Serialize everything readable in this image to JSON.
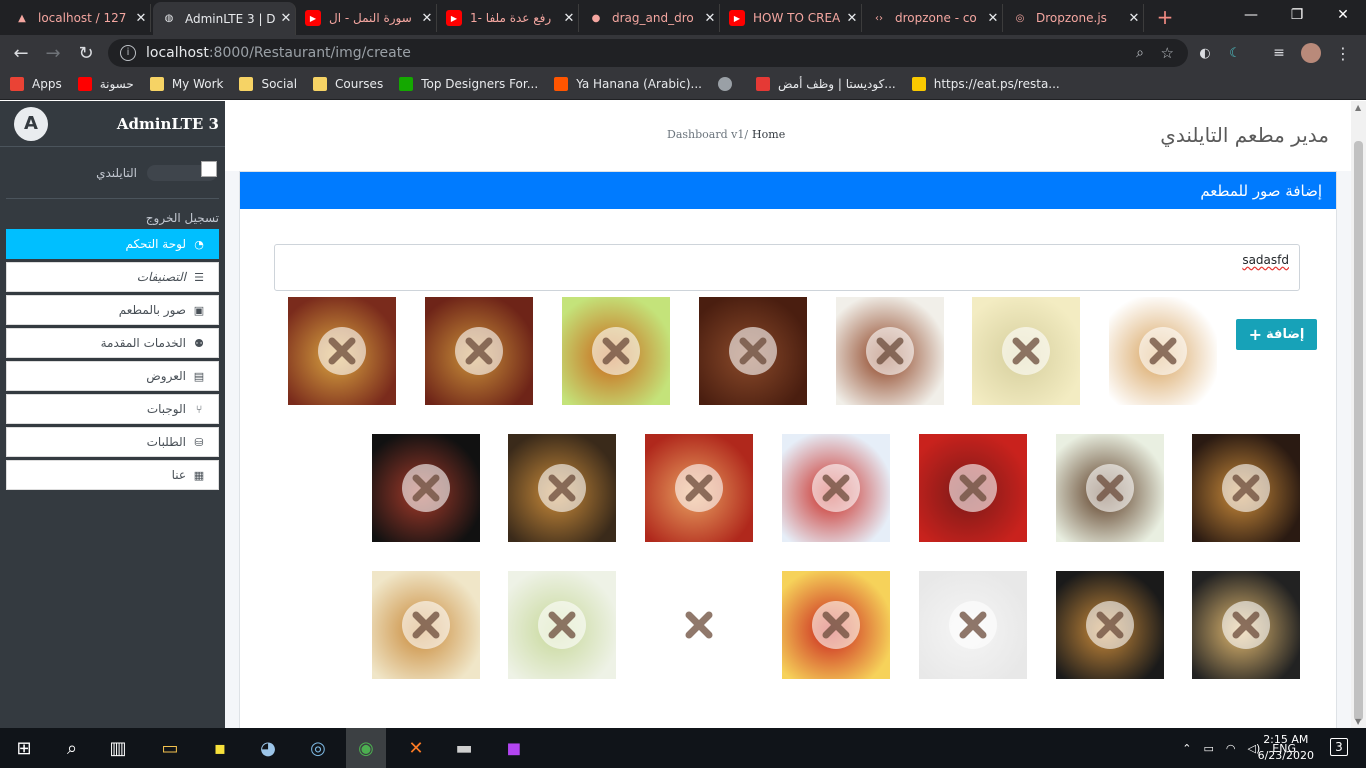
{
  "browser": {
    "tabs": [
      {
        "label": "localhost / 127",
        "favicon": "phpmyadmin-icon",
        "color": "#f28b82"
      },
      {
        "label": "AdminLTE 3 | D",
        "favicon": "globe-icon",
        "active": true
      },
      {
        "label": "سورة النمل - ال",
        "favicon": "youtube-icon",
        "color": "#f28b82"
      },
      {
        "label": "1- رفع عدة ملفا",
        "favicon": "youtube-icon",
        "color": "#f28b82"
      },
      {
        "label": "drag_and_dro",
        "favicon": "github-icon",
        "color": "#f28b82"
      },
      {
        "label": "HOW TO CREA",
        "favicon": "youtube-icon",
        "color": "#f28b82"
      },
      {
        "label": "dropzone - co",
        "favicon": "code-icon",
        "color": "#f28b82"
      },
      {
        "label": "Dropzone.js",
        "favicon": "dropzone-icon",
        "color": "#f28b82"
      }
    ],
    "new_tab": "+",
    "window_controls": {
      "minimize": "—",
      "maximize": "❐",
      "close": "✕"
    },
    "url_host": "localhost",
    "url_path": ":8000/Restaurant/img/create",
    "bookmarks": [
      {
        "label": "Apps",
        "icon": "apps-grid-icon",
        "color": "#ea4335"
      },
      {
        "label": "حسونة",
        "icon": "youtube-icon",
        "color": "#ff0000"
      },
      {
        "label": "My Work",
        "icon": "folder-icon",
        "color": "#f6d365"
      },
      {
        "label": "Social",
        "icon": "folder-icon",
        "color": "#f6d365"
      },
      {
        "label": "Courses",
        "icon": "folder-icon",
        "color": "#f6d365"
      },
      {
        "label": "Top Designers For...",
        "icon": "upwork-icon",
        "color": "#14a800"
      },
      {
        "label": "Ya Hanana (Arabic)...",
        "icon": "soundcloud-icon",
        "color": "#ff5500"
      },
      {
        "label": "",
        "icon": "globe-icon",
        "color": "#9aa0a6"
      },
      {
        "label": "كوديستا | وظف أمض...",
        "icon": "codista-icon",
        "color": "#e53935"
      },
      {
        "label": "https://eat.ps/resta...",
        "icon": "eat-ps-icon",
        "color": "#f9c900"
      }
    ]
  },
  "sidebar": {
    "brand": "AdminLTE 3",
    "brand_logo": "A",
    "user_name": "التايلندي",
    "logout": "تسجيل الخروج",
    "items": [
      {
        "label": "لوحة التحكم",
        "icon": "tachometer-icon",
        "active": true
      },
      {
        "label": "التصنيفات",
        "icon": "list-icon"
      },
      {
        "label": "صور بالمطعم",
        "icon": "image-icon"
      },
      {
        "label": "الخدمات المقدمة",
        "icon": "users-icon"
      },
      {
        "label": "العروض",
        "icon": "ad-icon"
      },
      {
        "label": "الوجبات",
        "icon": "utensils-icon"
      },
      {
        "label": "الطلبات",
        "icon": "basket-icon"
      },
      {
        "label": "عنا",
        "icon": "id-card-icon"
      }
    ]
  },
  "header": {
    "breadcrumb_prefix": "Dashboard v1/",
    "breadcrumb_current": "Home",
    "page_title": "مدير مطعم التايلندي"
  },
  "card": {
    "title": "إضافة صور للمطعم",
    "textarea_value": "sadasfd",
    "add_button": "إضافة",
    "add_icon": "+"
  },
  "gallery": [
    {
      "name": "pizza-image",
      "colors": [
        "#7a2b1c",
        "#d9a441"
      ]
    },
    {
      "name": "pizza-image",
      "colors": [
        "#6e2418",
        "#c9903a"
      ]
    },
    {
      "name": "tea-image",
      "colors": [
        "#c4e37a",
        "#c9671a"
      ]
    },
    {
      "name": "chocolate-image",
      "colors": [
        "#4a1e10",
        "#8a4a2a"
      ]
    },
    {
      "name": "kebab-image",
      "colors": [
        "#f1efe9",
        "#8b3e1e"
      ]
    },
    {
      "name": "quote-image",
      "colors": [
        "#f3ecc2",
        "#d6cf9e"
      ]
    },
    {
      "name": "wrap-image",
      "colors": [
        "#ffffff",
        "#d8a460"
      ]
    },
    {
      "name": "menu-poster-image",
      "colors": [
        "#111111",
        "#a33a2a"
      ]
    },
    {
      "name": "restaurant-front-image",
      "colors": [
        "#3a2a1a",
        "#c88a3a"
      ]
    },
    {
      "name": "food-truck-image",
      "colors": [
        "#b0281c",
        "#e8a060"
      ]
    },
    {
      "name": "storefront-image",
      "colors": [
        "#e6eef8",
        "#c92a22"
      ]
    },
    {
      "name": "staff-image",
      "colors": [
        "#c9221d",
        "#7a1a18"
      ]
    },
    {
      "name": "meat-salad-image",
      "colors": [
        "#e9efe1",
        "#5a3a22"
      ]
    },
    {
      "name": "rice-meat-image",
      "colors": [
        "#2a1a12",
        "#c98a3a"
      ]
    },
    {
      "name": "lasagna-image",
      "colors": [
        "#f0e6c8",
        "#c98a3a"
      ]
    },
    {
      "name": "juice-image",
      "colors": [
        "#eef2e6",
        "#c7d89a"
      ]
    },
    {
      "name": "restaurant-logo-image",
      "colors": [
        "#ffffff",
        "#ffffff"
      ]
    },
    {
      "name": "interior-image",
      "colors": [
        "#f6d25a",
        "#c9221d"
      ]
    },
    {
      "name": "business-logo-image",
      "colors": [
        "#e8e8e8",
        "#f5f5f5"
      ]
    },
    {
      "name": "pizza-ad-image",
      "colors": [
        "#1a1a1a",
        "#c98a3a"
      ]
    },
    {
      "name": "pizza-top-image",
      "colors": [
        "#222222",
        "#e0b870"
      ]
    }
  ],
  "taskbar": {
    "items": [
      "windows-icon",
      "search-icon",
      "task-view-icon",
      "file-explorer-icon",
      "sticky-notes-icon",
      "paint-icon",
      "network-icon",
      "chrome-icon",
      "xampp-icon",
      "terminal-icon",
      "phpstorm-icon"
    ],
    "lang": "ENG",
    "time": "2:15 AM",
    "date": "6/23/2020",
    "notifications": "3"
  }
}
